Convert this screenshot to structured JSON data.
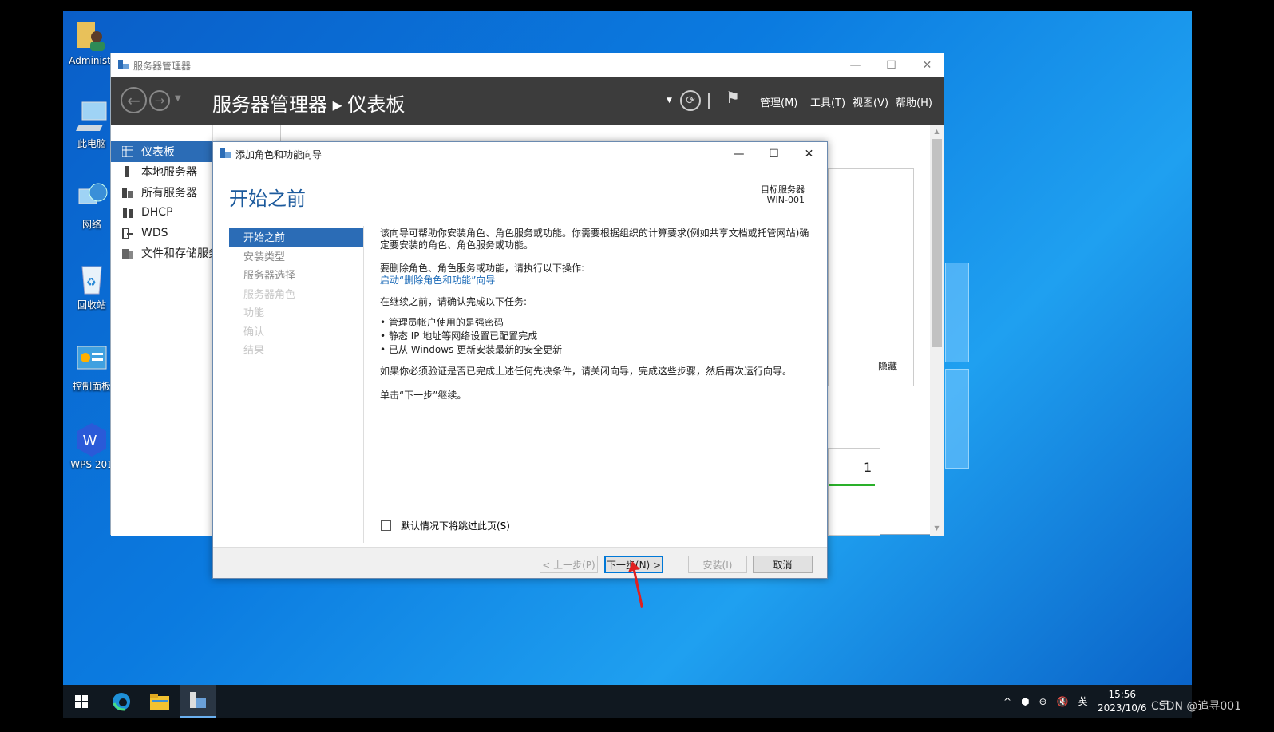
{
  "desktop": {
    "icons": [
      {
        "label": "Administr"
      },
      {
        "label": "此电脑"
      },
      {
        "label": "网络"
      },
      {
        "label": "回收站"
      },
      {
        "label": "控制面板"
      },
      {
        "label": "WPS 201"
      }
    ]
  },
  "server_manager": {
    "window_title": "服务器管理器",
    "breadcrumb": "服务器管理器 ▸ 仪表板",
    "menus": [
      "管理(M)",
      "工具(T)",
      "视图(V)",
      "帮助(H)"
    ],
    "sidebar": [
      {
        "label": "仪表板",
        "selected": true
      },
      {
        "label": "本地服务器"
      },
      {
        "label": "所有服务器"
      },
      {
        "label": "DHCP"
      },
      {
        "label": "WDS"
      },
      {
        "label": "文件和存储服务"
      }
    ],
    "hide_label": "隐藏",
    "tile_count": "1"
  },
  "wizard": {
    "window_title": "添加角色和功能向导",
    "heading": "开始之前",
    "target_label": "目标服务器",
    "target_name": "WIN-001",
    "steps": [
      {
        "label": "开始之前",
        "state": "current"
      },
      {
        "label": "安装类型",
        "state": "enabled"
      },
      {
        "label": "服务器选择",
        "state": "enabled"
      },
      {
        "label": "服务器角色",
        "state": "disabled"
      },
      {
        "label": "功能",
        "state": "disabled"
      },
      {
        "label": "确认",
        "state": "disabled"
      },
      {
        "label": "结果",
        "state": "disabled"
      }
    ],
    "content": {
      "intro": "该向导可帮助你安装角色、角色服务或功能。你需要根据组织的计算要求(例如共享文档或托管网站)确定要安装的角色、角色服务或功能。",
      "remove_text": "要删除角色、角色服务或功能，请执行以下操作:",
      "remove_link": "启动“删除角色和功能”向导",
      "before_text": "在继续之前，请确认完成以下任务:",
      "bullets": [
        "管理员帐户使用的是强密码",
        "静态 IP 地址等网络设置已配置完成",
        "已从 Windows 更新安装最新的安全更新"
      ],
      "verify_text": "如果你必须验证是否已完成上述任何先决条件，请关闭向导，完成这些步骤，然后再次运行向导。",
      "continue_text": "单击“下一步”继续。"
    },
    "skip_label": "默认情况下将跳过此页(S)",
    "buttons": {
      "prev": "< 上一步(P)",
      "next": "下一步(N) >",
      "install": "安装(I)",
      "cancel": "取消"
    }
  },
  "taskbar": {
    "time": "15:56",
    "date": "2023/10/6",
    "ime": "英",
    "watermark": "CSDN @追寻001"
  },
  "colors": {
    "accent": "#2b6cb6",
    "header_bg": "#3c3c3c",
    "desktop": "#0b7be0",
    "arrow": "#e02020"
  }
}
